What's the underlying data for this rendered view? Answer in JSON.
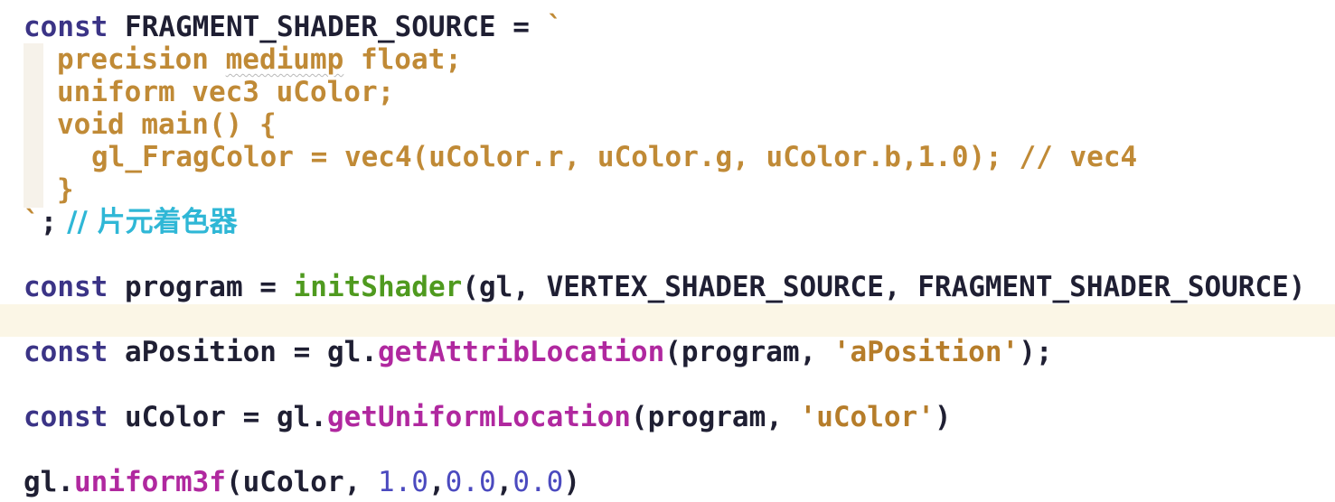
{
  "editor": {
    "colors": {
      "keyword": "#3b3486",
      "function": "#4f9a1f",
      "method": "#b0289f",
      "template_string": "#c08a36",
      "string": "#b67d2a",
      "number": "#4b4abf",
      "comment": "#2fb7d6",
      "current_line_highlight": "#fbf6e6"
    },
    "lines": {
      "l1": {
        "kw": "const",
        "rest": " FRAGMENT_SHADER_SOURCE = ",
        "tick": "`"
      },
      "l2": {
        "a": "precision ",
        "b": "mediump",
        "c": " float;"
      },
      "l3": {
        "text": "uniform vec3 uColor;"
      },
      "l4": {
        "text": "void main() {"
      },
      "l5": {
        "text": "gl_FragColor = vec4(uColor.r, uColor.g, uColor.b,1.0); // vec4"
      },
      "l6": {
        "text": "}"
      },
      "l7": {
        "tick": "`",
        "semi": ";",
        "comment": " // 片元着色器"
      },
      "l9": {
        "kw": "const",
        "a": " program = ",
        "fn": "initShader",
        "b": "(gl, VERTEX_SHADER_SOURCE, FRAGMENT_SHADER_SOURCE)"
      },
      "l11": {
        "kw": "const",
        "a": " aPosition = gl.",
        "fn": "getAttribLocation",
        "b": "(program, ",
        "str": "'aPosition'",
        "c": ");"
      },
      "l13": {
        "kw": "const",
        "a": " uColor = gl.",
        "fn": "getUniformLocation",
        "b": "(program, ",
        "str": "'uColor'",
        "c": ")"
      },
      "l15": {
        "a": "gl.",
        "fn": "uniform3f",
        "b": "(uColor, ",
        "n1": "1.0",
        "c1": ",",
        "n2": "0.0",
        "c2": ",",
        "n3": "0.0",
        "c": ")"
      }
    }
  }
}
